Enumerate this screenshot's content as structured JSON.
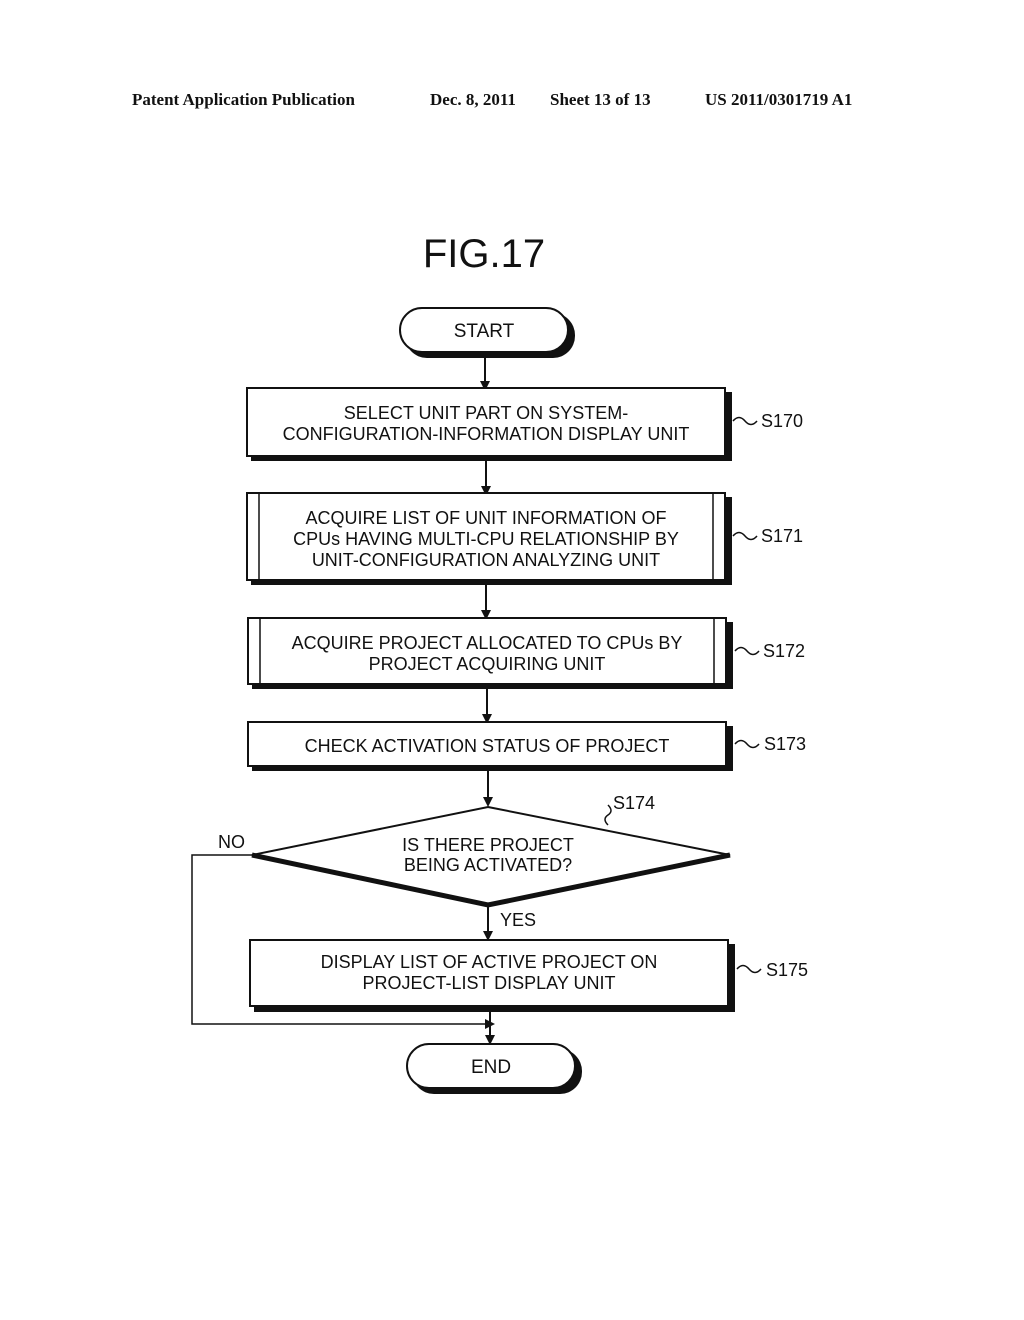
{
  "header": {
    "publication": "Patent Application Publication",
    "date": "Dec. 8, 2011",
    "sheet": "Sheet 13 of 13",
    "number": "US 2011/0301719 A1"
  },
  "figure": {
    "title": "FIG.17",
    "start": "START",
    "end": "END",
    "steps": [
      {
        "id": "S170",
        "type": "process",
        "lines": [
          "SELECT UNIT PART ON SYSTEM-",
          "CONFIGURATION-INFORMATION DISPLAY UNIT"
        ]
      },
      {
        "id": "S171",
        "type": "predefined",
        "lines": [
          "ACQUIRE LIST OF UNIT INFORMATION OF",
          "CPUs HAVING MULTI-CPU RELATIONSHIP BY",
          "UNIT-CONFIGURATION ANALYZING UNIT"
        ]
      },
      {
        "id": "S172",
        "type": "predefined",
        "lines": [
          "ACQUIRE PROJECT ALLOCATED TO CPUs BY",
          "PROJECT ACQUIRING UNIT"
        ]
      },
      {
        "id": "S173",
        "type": "process",
        "lines": [
          "CHECK ACTIVATION STATUS OF PROJECT"
        ]
      },
      {
        "id": "S174",
        "type": "decision",
        "lines": [
          "IS THERE PROJECT",
          "BEING ACTIVATED?"
        ]
      },
      {
        "id": "S175",
        "type": "process",
        "lines": [
          "DISPLAY LIST OF ACTIVE PROJECT ON",
          "PROJECT-LIST DISPLAY UNIT"
        ]
      }
    ],
    "branches": {
      "yes": "YES",
      "no": "NO"
    }
  }
}
